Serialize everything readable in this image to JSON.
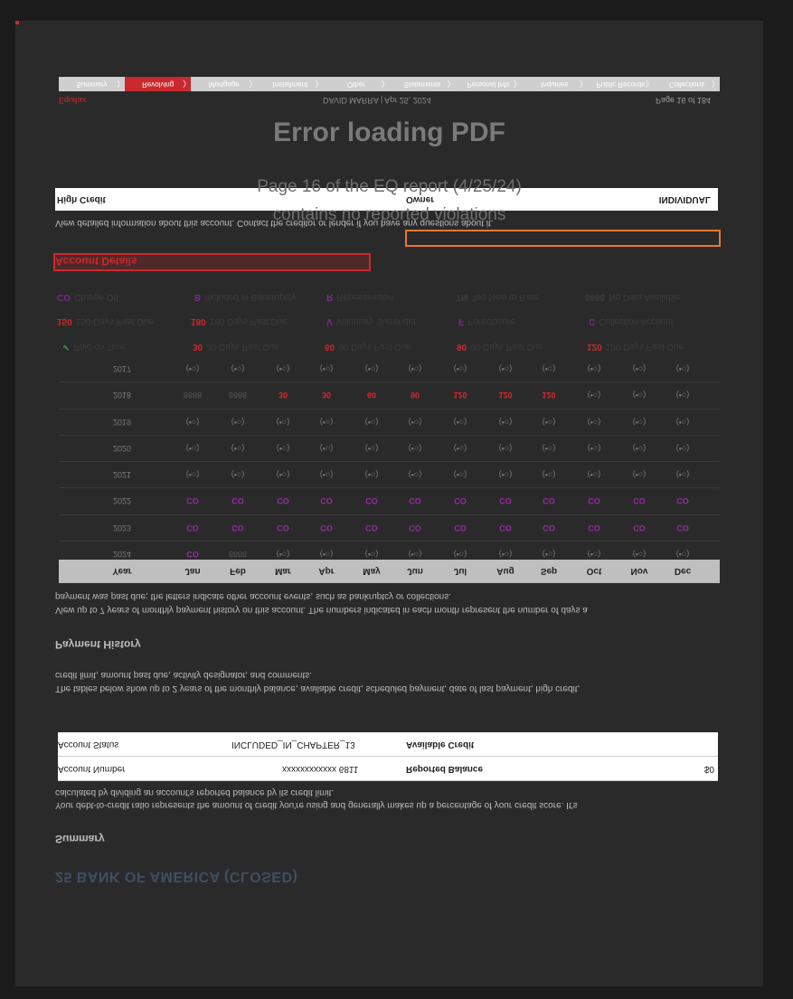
{
  "error": {
    "title": "Error loading PDF",
    "message_line1": "Page 16 of the EQ report (4/25/24)",
    "message_line2": "contains no reported violations"
  },
  "nav_tabs": [
    {
      "label": "Summary",
      "active": false
    },
    {
      "label": "Revolving",
      "active": true
    },
    {
      "label": "Mortgage",
      "active": false
    },
    {
      "label": "Installment",
      "active": false
    },
    {
      "label": "Other",
      "active": false
    },
    {
      "label": "Statements",
      "active": false
    },
    {
      "label": "Personal Info",
      "active": false
    },
    {
      "label": "Inquiries",
      "active": false
    },
    {
      "label": "Public Records",
      "active": false
    },
    {
      "label": "Collections",
      "active": false
    }
  ],
  "header": {
    "brand": "Equifax",
    "person_date": "DAVID MARRA | Apr 25, 2024",
    "page": "Page 16 of 184"
  },
  "owner_bar": {
    "left": "High Credit",
    "owner_label": "Owner",
    "owner_value": "INDIVIDUAL"
  },
  "account_details": {
    "intro": "View detailed information about this account. Contact the creditor or lender if you have any questions about it.",
    "title": "Account Details"
  },
  "legend": [
    {
      "code": "CO",
      "label": "Charge Off",
      "color": "#7a2a8a"
    },
    {
      "code": "B",
      "label": "Included in Bankruptcy",
      "color": "#7a2a8a"
    },
    {
      "code": "R",
      "label": "Repossession",
      "color": "#7a2a8a"
    },
    {
      "code": "TN",
      "label": "Too New to Rate",
      "color": "#555555"
    },
    {
      "code": "8888",
      "label": "No Data Available",
      "color": "#555555"
    },
    {
      "code": "150",
      "label": "150 Days Past Due",
      "color": "#c9292e"
    },
    {
      "code": "180",
      "label": "180 Days Past Due",
      "color": "#c9292e"
    },
    {
      "code": "V",
      "label": "Voluntary Surrender",
      "color": "#7a2a8a"
    },
    {
      "code": "F",
      "label": "Foreclosure",
      "color": "#7a2a8a"
    },
    {
      "code": "C",
      "label": "Collection Account",
      "color": "#7a2a8a"
    },
    {
      "code": "✔",
      "label": "Paid on Time",
      "color": "#3a8a3a"
    },
    {
      "code": "30",
      "label": "30 Days Past Due",
      "color": "#c9292e"
    },
    {
      "code": "60",
      "label": "60 Days Past Due",
      "color": "#c9292e"
    },
    {
      "code": "90",
      "label": "90 Days Past Due",
      "color": "#c9292e"
    },
    {
      "code": "120",
      "label": "120 Days Past Due",
      "color": "#c9292e"
    }
  ],
  "payment_history": {
    "title": "Payment History",
    "intro_line1": "View up to 7 years of monthly payment history on this account. The numbers indicated in each month represent the number of days a",
    "intro_line2": "payment was past due; the letters indicate other account events, such as bankruptcy or collections.",
    "columns": [
      "Year",
      "Jan",
      "Feb",
      "Mar",
      "Apr",
      "May",
      "Jun",
      "Jul",
      "Aug",
      "Sep",
      "Oct",
      "Nov",
      "Dec"
    ],
    "rows": [
      {
        "year": "2017",
        "cells": [
          "(•○)",
          "(•○)",
          "(•○)",
          "(•○)",
          "(•○)",
          "(•○)",
          "(•○)",
          "(•○)",
          "(•○)",
          "(•○)",
          "(•○)",
          "(•○)"
        ]
      },
      {
        "year": "2018",
        "cells": [
          "8888",
          "8888",
          "30",
          "30",
          "60",
          "90",
          "120",
          "120",
          "120",
          "(•○)",
          "(•○)",
          "(•○)"
        ]
      },
      {
        "year": "2019",
        "cells": [
          "(•○)",
          "(•○)",
          "(•○)",
          "(•○)",
          "(•○)",
          "(•○)",
          "(•○)",
          "(•○)",
          "(•○)",
          "(•○)",
          "(•○)",
          "(•○)"
        ]
      },
      {
        "year": "2020",
        "cells": [
          "(•○)",
          "(•○)",
          "(•○)",
          "(•○)",
          "(•○)",
          "(•○)",
          "(•○)",
          "(•○)",
          "(•○)",
          "(•○)",
          "(•○)",
          "(•○)"
        ]
      },
      {
        "year": "2021",
        "cells": [
          "(•○)",
          "(•○)",
          "(•○)",
          "(•○)",
          "(•○)",
          "(•○)",
          "(•○)",
          "(•○)",
          "(•○)",
          "(•○)",
          "(•○)",
          "(•○)"
        ]
      },
      {
        "year": "2022",
        "cells": [
          "CO",
          "CO",
          "CO",
          "CO",
          "CO",
          "CO",
          "CO",
          "CO",
          "CO",
          "CO",
          "CO",
          "CO"
        ]
      },
      {
        "year": "2023",
        "cells": [
          "CO",
          "CO",
          "CO",
          "CO",
          "CO",
          "CO",
          "CO",
          "CO",
          "CO",
          "CO",
          "CO",
          "CO"
        ]
      },
      {
        "year": "2024",
        "cells": [
          "CO",
          "8888",
          "(•○)",
          "(•○)",
          "(•○)",
          "(•○)",
          "(•○)",
          "(•○)",
          "(•○)",
          "(•○)",
          "(•○)",
          "(•○)"
        ]
      }
    ]
  },
  "balances": {
    "intro_line1": "The tables below show up to 2 years of the monthly balance, available credit, scheduled payment, date of last payment, high credit,",
    "intro_line2": "credit limit, amount past due, activity designator, and comments."
  },
  "summary": {
    "title": "Summary",
    "intro_line1": "Your debt-to-credit ratio represents the amount of credit you're using and generally makes up a percentage of your credit score. It's",
    "intro_line2": "calculated by dividing an account's reported balance by its credit limit.",
    "rows": [
      {
        "k1": "Account Status",
        "v1": "INCLUDED_IN_CHAPTER_13",
        "k2": "Available Credit",
        "v2": ""
      },
      {
        "k1": "Account Number",
        "v1": "xxxxxxxxxxxx 6811",
        "k2": "Reported Balance",
        "v2": "$0"
      }
    ]
  },
  "bank_title": "25 BANK OF AMERICA (CLOSED)"
}
